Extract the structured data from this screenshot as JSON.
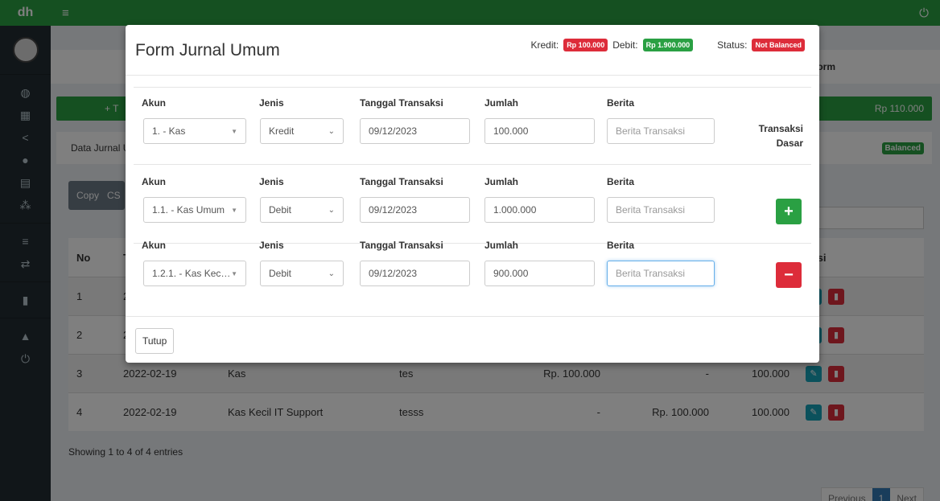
{
  "app": {
    "logo_text": "dh",
    "menu_icon": "hamburger-icon",
    "power_icon": "power-icon"
  },
  "colors": {
    "brand": "#2aa043",
    "danger": "#dd2c3a",
    "sidebar": "#222d32",
    "info": "#17a2b8",
    "primary": "#337ab7"
  },
  "sidebar_icons": [
    "dashboard-icon",
    "building-icon",
    "share-icon",
    "user-icon",
    "list-icon",
    "users-icon",
    "tasks-icon",
    "exchange-icon",
    "file-icon",
    "lock-icon",
    "power-icon"
  ],
  "background": {
    "header_partial": "form",
    "green_bar": {
      "add_prefix": "+ T",
      "amount": "Rp 110.000"
    },
    "data_bar": {
      "label": "Data Jurnal U",
      "badge": "Balanced"
    },
    "buttons": {
      "copy": "Copy",
      "csv": "CS"
    },
    "table": {
      "headers": {
        "no": "No",
        "tgl": "T",
        "aksi": "Aksi"
      },
      "rows": [
        {
          "no": "1",
          "tgl": "2",
          "akun": "",
          "ket": "",
          "debit": "",
          "kredit": "",
          "saldo": ""
        },
        {
          "no": "2",
          "tgl": "2",
          "akun": "",
          "ket": "",
          "debit": "",
          "kredit": "",
          "saldo": ""
        },
        {
          "no": "3",
          "tgl": "2022-02-19",
          "akun": "Kas",
          "ket": "tes",
          "debit": "Rp. 100.000",
          "kredit": "-",
          "saldo": "100.000"
        },
        {
          "no": "4",
          "tgl": "2022-02-19",
          "akun": "Kas Kecil IT Support",
          "ket": "tesss",
          "debit": "-",
          "kredit": "Rp. 100.000",
          "saldo": "100.000"
        }
      ]
    },
    "info": "Showing 1 to 4 of 4 entries",
    "pager": {
      "previous": "Previous",
      "page": "1",
      "next": "Next"
    }
  },
  "modal": {
    "title": "Form Jurnal Umum",
    "kredit_label": "Kredit:",
    "kredit_value": "Rp 100.000",
    "debit_label": "Debit:",
    "debit_value": "Rp 1.900.000",
    "status_label": "Status:",
    "status_value": "Not Balanced",
    "labels": {
      "akun": "Akun",
      "jenis": "Jenis",
      "tanggal": "Tanggal Transaksi",
      "jumlah": "Jumlah",
      "berita": "Berita"
    },
    "transaksi_dasar": [
      "Transaksi",
      "Dasar"
    ],
    "rows": [
      {
        "akun": "1. - Kas",
        "jenis": "Kredit",
        "tanggal": "09/12/2023",
        "jumlah": "100.000",
        "berita_placeholder": "Berita Transaksi"
      },
      {
        "akun": "1.1. - Kas Umum",
        "jenis": "Debit",
        "tanggal": "09/12/2023",
        "jumlah": "1.000.000",
        "berita_placeholder": "Berita Transaksi"
      },
      {
        "akun": "1.2.1. - Kas Kec…",
        "jenis": "Debit",
        "tanggal": "09/12/2023",
        "jumlah": "900.000",
        "berita_placeholder": "Berita Transaksi"
      }
    ],
    "add_symbol": "+",
    "remove_symbol": "−",
    "close_label": "Tutup"
  }
}
